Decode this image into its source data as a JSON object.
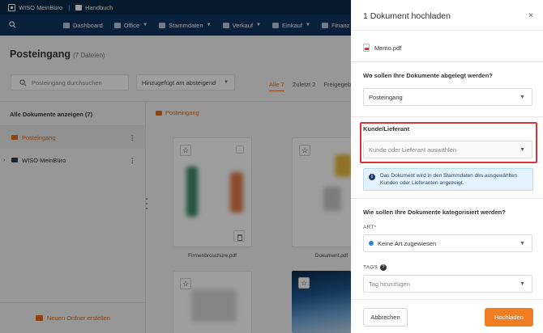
{
  "app": {
    "name": "WISO MeinBüro",
    "handbook": "Handbuch"
  },
  "nav": [
    {
      "label": "Dashboard",
      "chevron": false
    },
    {
      "label": "Office",
      "chevron": true
    },
    {
      "label": "Stammdaten",
      "chevron": true
    },
    {
      "label": "Verkauf",
      "chevron": true
    },
    {
      "label": "Einkauf",
      "chevron": true
    },
    {
      "label": "Finanz",
      "chevron": false
    }
  ],
  "page": {
    "title": "Posteingang",
    "count": "(7 Dateien)",
    "search_placeholder": "Posteingang durchsuchen",
    "sort_value": "Hinzugefügt am absteigend",
    "filters": [
      {
        "label": "Alle",
        "count": "7"
      },
      {
        "label": "Zuletzt",
        "count": "2"
      },
      {
        "label": "Freigegeben",
        "count": ""
      }
    ]
  },
  "sidebar": {
    "header": "Alle Dokumente anzeigen (7)",
    "items": [
      {
        "label": "Posteingang"
      },
      {
        "label": "WISO MeinBüro"
      }
    ],
    "new_folder": "Neuen Ordner erstellen"
  },
  "content": {
    "breadcrumb": "Posteingang",
    "files": [
      {
        "name": "Firmenbroschüre.pdf"
      },
      {
        "name": "Dokument.pdf"
      }
    ]
  },
  "dialog": {
    "title": "1 Dokument hochladen",
    "close": "×",
    "file_name": "Memo.pdf",
    "q_location": "Wo sollen Ihre Dokumente abgelegt werden?",
    "location_value": "Posteingang",
    "customer_label": "Kunde/Lieferant",
    "customer_placeholder": "Kunde oder Lieferant auswählen",
    "info_text": "Das Dokument wird in den Stammdaten des ausgewählten Kunden oder Lieferanten angezeigt.",
    "q_categorize": "Wie sollen Ihre Dokumente kategorisiert werden?",
    "art_label": "ART*",
    "art_value": "Keine Art zugewiesen",
    "tags_label": "TAGS",
    "tags_placeholder": "Tag hinzufügen",
    "cancel": "Abbrechen",
    "upload": "Hochladen"
  },
  "colors": {
    "accent": "#ef7d22",
    "navy": "#0e3560",
    "highlight": "#e0303a",
    "info_bg": "#e3f2fd"
  }
}
